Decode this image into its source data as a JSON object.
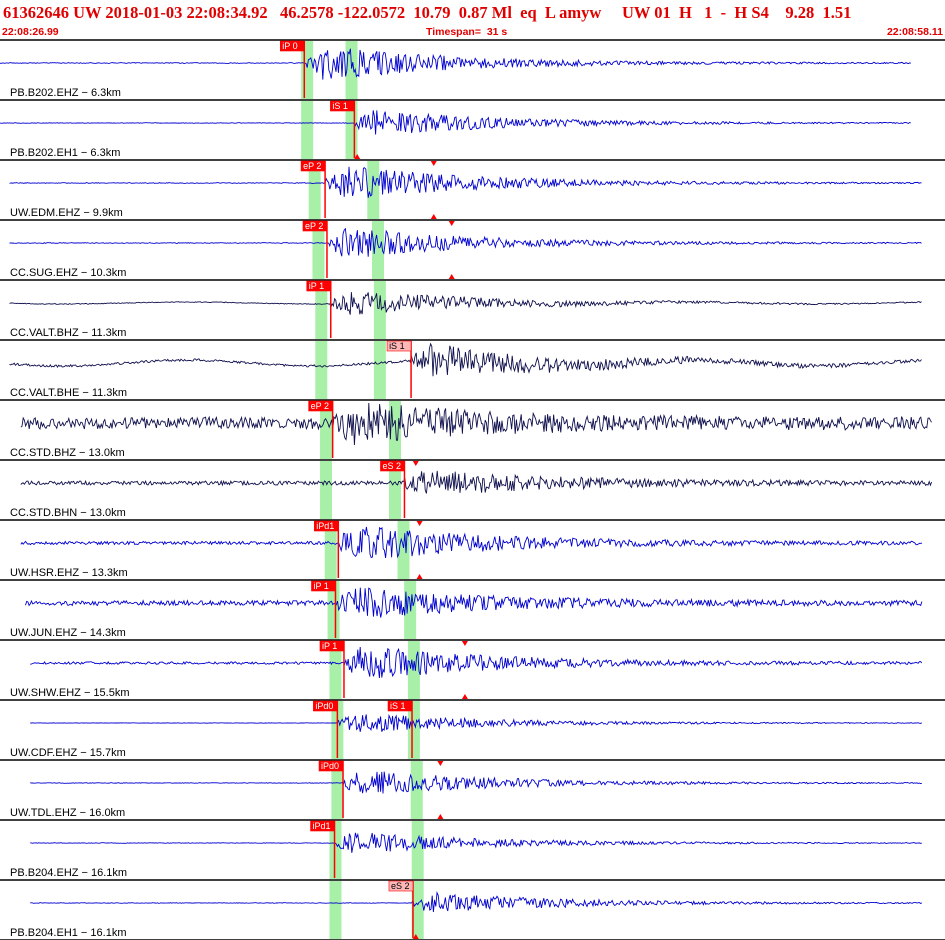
{
  "header": {
    "event_id": "61362646",
    "network": "UW",
    "origin_date": "2018-01-03",
    "origin_time": "22:08:34.92",
    "latitude": "46.2578",
    "longitude": "-122.0572",
    "depth": "10.79",
    "magnitude": "0.87",
    "mag_type": "Ml",
    "event_type": "eq",
    "location_type": "L",
    "analyst": "amyw",
    "source": "UW",
    "version": "01",
    "review_flag": "H",
    "quality": "1",
    "dash": "-",
    "solution_type": "H",
    "solution_id": "S4",
    "value_a": "9.28",
    "value_b": "1.51"
  },
  "timebar": {
    "start_time": "22:08:26.99",
    "timespan_label": "Timespan=",
    "timespan_value": "31 s",
    "end_time": "22:08:58.11"
  },
  "colors": {
    "header_text": "#e00000",
    "trace_blue": "#0000d0",
    "trace_navy": "#10104e",
    "pick_red": "#ff0000",
    "pick_pink": "#ffb6b6",
    "window_green": "#a8f0a8",
    "separator": "#000000"
  },
  "channels": [
    {
      "label": "PB.B202.EHZ",
      "distance": "6.3km",
      "color": "blue",
      "start": 0.0,
      "end": 0.965,
      "onset": 0.323,
      "amp": 1.0,
      "noise": 0.02,
      "drift": 0.0,
      "windows": [
        0.325,
        0.372
      ],
      "picks": [
        {
          "t": 0.322,
          "label": "iP 0",
          "style": "red"
        }
      ],
      "peaks": []
    },
    {
      "label": "PB.B202.EH1",
      "distance": "6.3km",
      "color": "blue",
      "start": 0.0,
      "end": 0.965,
      "onset": 0.375,
      "amp": 0.75,
      "noise": 0.015,
      "drift": 0.0,
      "windows": [
        0.325,
        0.372
      ],
      "picks": [
        {
          "t": 0.375,
          "label": "iS 1",
          "style": "red"
        }
      ],
      "peaks": [
        {
          "t": 0.378,
          "dir": "up"
        }
      ]
    },
    {
      "label": "UW.EDM.EHZ",
      "distance": "9.9km",
      "color": "blue",
      "start": 0.01,
      "end": 0.976,
      "onset": 0.345,
      "amp": 1.0,
      "noise": 0.02,
      "drift": 0.0,
      "windows": [
        0.333,
        0.395
      ],
      "picks": [
        {
          "t": 0.344,
          "label": "eP 2",
          "style": "red"
        }
      ],
      "peaks": [
        {
          "t": 0.459,
          "dir": "both"
        }
      ]
    },
    {
      "label": "CC.SUG.EHZ",
      "distance": "10.3km",
      "color": "blue",
      "start": 0.01,
      "end": 0.976,
      "onset": 0.347,
      "amp": 0.9,
      "noise": 0.02,
      "drift": 0.0,
      "windows": [
        0.337,
        0.4
      ],
      "picks": [
        {
          "t": 0.346,
          "label": "eP 2",
          "style": "red"
        }
      ],
      "peaks": [
        {
          "t": 0.478,
          "dir": "both"
        }
      ]
    },
    {
      "label": "CC.VALT.BHZ",
      "distance": "11.3km",
      "color": "navy",
      "start": 0.01,
      "end": 0.976,
      "onset": 0.35,
      "amp": 0.7,
      "noise": 0.02,
      "drift": 0.2,
      "windows": [
        0.34,
        0.402
      ],
      "picks": [
        {
          "t": 0.35,
          "label": "iP 1",
          "style": "red"
        }
      ],
      "peaks": []
    },
    {
      "label": "CC.VALT.BHE",
      "distance": "11.3km",
      "color": "navy",
      "start": 0.01,
      "end": 0.976,
      "onset": 0.435,
      "amp": 0.9,
      "noise": 0.06,
      "drift": 0.6,
      "windows": [
        0.34,
        0.402
      ],
      "picks": [
        {
          "t": 0.435,
          "label": "iS 1",
          "style": "pink"
        }
      ],
      "peaks": []
    },
    {
      "label": "CC.STD.BHZ",
      "distance": "13.0km",
      "color": "navy",
      "start": 0.022,
      "end": 0.987,
      "onset": 0.352,
      "amp": 1.0,
      "noise": 0.28,
      "drift": 0.1,
      "windows": [
        0.345,
        0.418
      ],
      "picks": [
        {
          "t": 0.352,
          "label": "eP 2",
          "style": "red"
        }
      ],
      "peaks": []
    },
    {
      "label": "CC.STD.BHN",
      "distance": "13.0km",
      "color": "navy",
      "start": 0.022,
      "end": 0.987,
      "onset": 0.428,
      "amp": 0.7,
      "noise": 0.1,
      "drift": 0.0,
      "windows": [
        0.345,
        0.418
      ],
      "picks": [
        {
          "t": 0.428,
          "label": "eS 2",
          "style": "red"
        }
      ],
      "peaks": [
        {
          "t": 0.44,
          "dir": "down"
        }
      ]
    },
    {
      "label": "UW.HSR.EHZ",
      "distance": "13.3km",
      "color": "blue",
      "start": 0.022,
      "end": 0.976,
      "onset": 0.358,
      "amp": 1.0,
      "noise": 0.08,
      "drift": 0.0,
      "windows": [
        0.35,
        0.427
      ],
      "picks": [
        {
          "t": 0.358,
          "label": "iPd1",
          "style": "red"
        }
      ],
      "peaks": [
        {
          "t": 0.444,
          "dir": "both"
        }
      ]
    },
    {
      "label": "UW.JUN.EHZ",
      "distance": "14.3km",
      "color": "blue",
      "start": 0.027,
      "end": 0.976,
      "onset": 0.355,
      "amp": 0.85,
      "noise": 0.12,
      "drift": 0.0,
      "windows": [
        0.353,
        0.434
      ],
      "picks": [
        {
          "t": 0.355,
          "label": "iP 1",
          "style": "red"
        }
      ],
      "peaks": []
    },
    {
      "label": "UW.SHW.EHZ",
      "distance": "15.5km",
      "color": "blue",
      "start": 0.032,
      "end": 0.976,
      "onset": 0.364,
      "amp": 0.95,
      "noise": 0.06,
      "drift": 0.0,
      "windows": [
        0.355,
        0.438
      ],
      "picks": [
        {
          "t": 0.364,
          "label": "iP 1",
          "style": "red"
        }
      ],
      "peaks": [
        {
          "t": 0.492,
          "dir": "both"
        }
      ]
    },
    {
      "label": "UW.CDF.EHZ",
      "distance": "15.7km",
      "color": "blue",
      "start": 0.032,
      "end": 0.976,
      "onset": 0.357,
      "amp": 0.6,
      "noise": 0.01,
      "drift": 0.0,
      "windows": [
        0.357,
        0.438
      ],
      "picks": [
        {
          "t": 0.357,
          "label": "iPd0",
          "style": "red"
        },
        {
          "t": 0.436,
          "label": "iS 1",
          "style": "red"
        }
      ],
      "peaks": []
    },
    {
      "label": "UW.TDL.EHZ",
      "distance": "16.0km",
      "color": "blue",
      "start": 0.032,
      "end": 0.976,
      "onset": 0.363,
      "amp": 0.75,
      "noise": 0.015,
      "drift": 0.0,
      "windows": [
        0.357,
        0.441
      ],
      "picks": [
        {
          "t": 0.363,
          "label": "iPd0",
          "style": "red"
        }
      ],
      "peaks": [
        {
          "t": 0.466,
          "dir": "both"
        }
      ]
    },
    {
      "label": "PB.B204.EHZ",
      "distance": "16.1km",
      "color": "blue",
      "start": 0.032,
      "end": 0.976,
      "onset": 0.354,
      "amp": 0.65,
      "noise": 0.015,
      "drift": 0.0,
      "windows": [
        0.355,
        0.442
      ],
      "picks": [
        {
          "t": 0.354,
          "label": "iPd1",
          "style": "red"
        }
      ],
      "peaks": []
    },
    {
      "label": "PB.B204.EH1",
      "distance": "16.1km",
      "color": "blue",
      "start": 0.032,
      "end": 0.976,
      "onset": 0.437,
      "amp": 0.6,
      "noise": 0.015,
      "drift": 0.0,
      "windows": [
        0.355,
        0.442
      ],
      "picks": [
        {
          "t": 0.437,
          "label": "eS 2",
          "style": "pink"
        }
      ],
      "peaks": [
        {
          "t": 0.44,
          "dir": "up"
        }
      ]
    }
  ]
}
